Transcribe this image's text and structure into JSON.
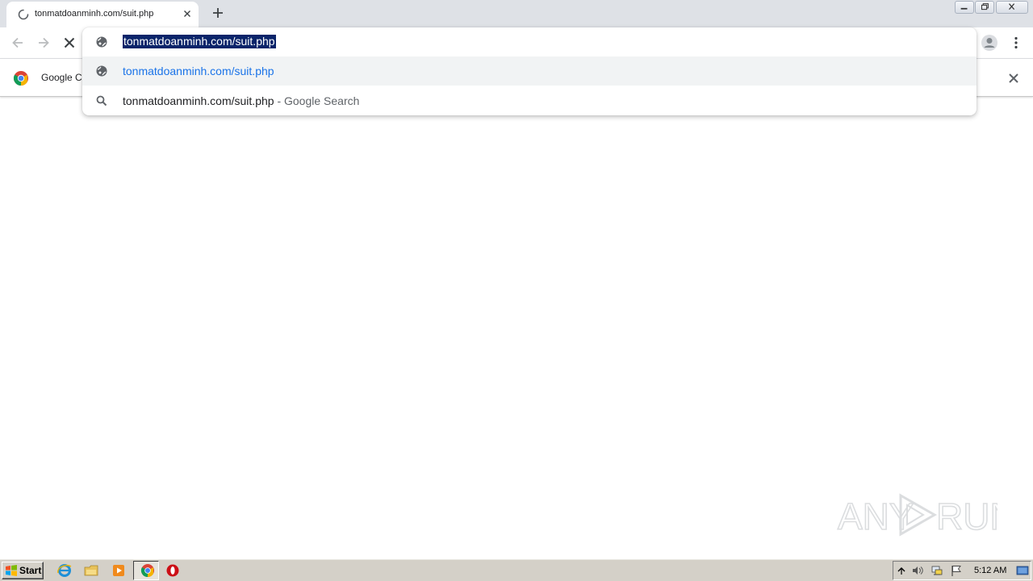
{
  "tab": {
    "title": "tonmatdoanminh.com/suit.php"
  },
  "omnibox": {
    "input_value": "tonmatdoanminh.com/suit.php",
    "suggestions": [
      {
        "icon": "globe-icon",
        "text": "tonmatdoanminh.com/suit.php",
        "suffix": ""
      },
      {
        "icon": "search-icon",
        "text": "tonmatdoanminh.com/suit.php",
        "suffix": " - Google Search"
      }
    ]
  },
  "infobar": {
    "text": "Google Cl"
  },
  "taskbar": {
    "start_label": "Start",
    "clock": "5:12 AM"
  },
  "watermark": {
    "left": "ANY",
    "right": "RUN"
  },
  "colors": {
    "selection": "#0a246a",
    "link": "#1a73e8",
    "tabstrip": "#dee1e6",
    "taskbar": "#d4d0c8"
  }
}
